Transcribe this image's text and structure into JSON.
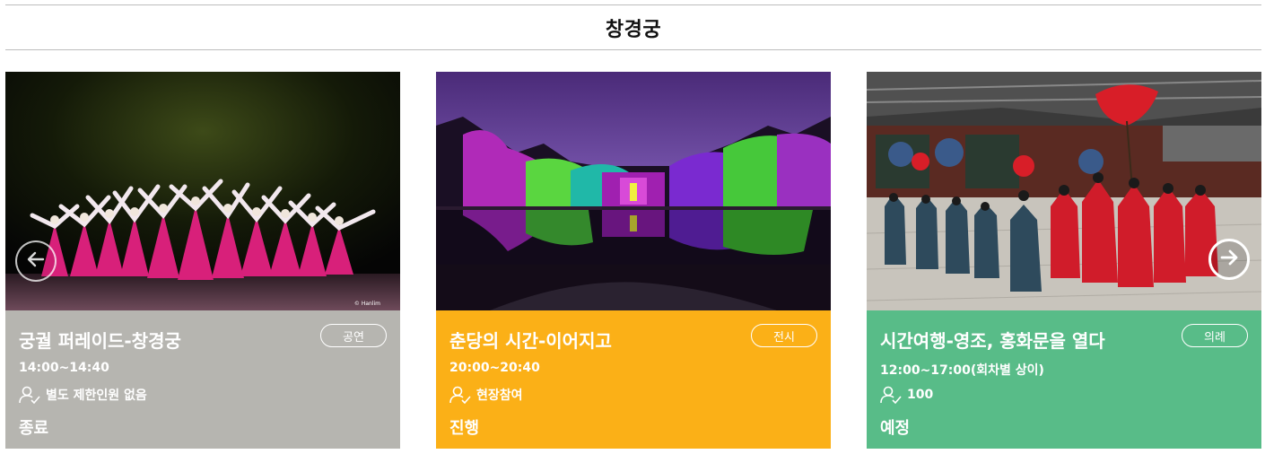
{
  "page": {
    "title": "창경궁"
  },
  "colors": {
    "ended": "#b6b5b0",
    "ongoing": "#fbb017",
    "scheduled": "#58bc88"
  },
  "icons": {
    "prev": "arrow-left-icon",
    "next": "arrow-right-icon",
    "person": "person-check-icon"
  },
  "cards": [
    {
      "title": "궁궐 퍼레이드-창경궁",
      "category": "공연",
      "time": "14:00~14:40",
      "capacity": "별도 제한인원 없음",
      "status": "종료",
      "watermark": "© Hanlim"
    },
    {
      "title": "춘당의 시간-이어지고",
      "category": "전시",
      "time": "20:00~20:40",
      "capacity": "현장참여",
      "status": "진행"
    },
    {
      "title": "시간여행-영조, 홍화문을 열다",
      "category": "의례",
      "time": "12:00~17:00(회차별 상이)",
      "capacity": "100",
      "status": "예정"
    }
  ]
}
